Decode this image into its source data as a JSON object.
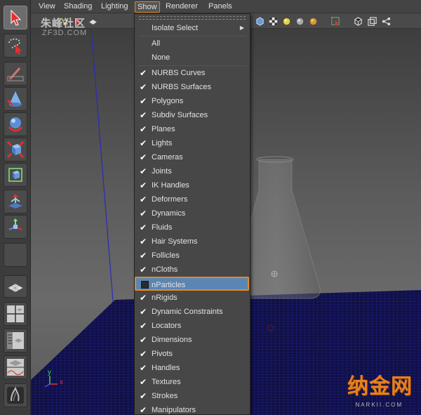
{
  "menubar": {
    "items": [
      {
        "label": "View"
      },
      {
        "label": "Shading"
      },
      {
        "label": "Lighting"
      },
      {
        "label": "Show"
      },
      {
        "label": "Renderer"
      },
      {
        "label": "Panels"
      }
    ]
  },
  "watermark": {
    "title": "朱峰社区",
    "subtitle": "ZF3D.COM"
  },
  "show_menu": {
    "isolate_label": "Isolate Select",
    "all_label": "All",
    "none_label": "None",
    "items": [
      {
        "label": "NURBS Curves",
        "checked": true
      },
      {
        "label": "NURBS Surfaces",
        "checked": true
      },
      {
        "label": "Polygons",
        "checked": true
      },
      {
        "label": "Subdiv Surfaces",
        "checked": true
      },
      {
        "label": "Planes",
        "checked": true
      },
      {
        "label": "Lights",
        "checked": true
      },
      {
        "label": "Cameras",
        "checked": true
      },
      {
        "label": "Joints",
        "checked": true
      },
      {
        "label": "IK Handles",
        "checked": true
      },
      {
        "label": "Deformers",
        "checked": true
      },
      {
        "label": "Dynamics",
        "checked": true
      },
      {
        "label": "Fluids",
        "checked": true
      },
      {
        "label": "Hair Systems",
        "checked": true
      },
      {
        "label": "Follicles",
        "checked": true
      },
      {
        "label": "nCloths",
        "checked": true
      },
      {
        "label": "nParticles",
        "checked": false
      },
      {
        "label": "nRigids",
        "checked": true
      },
      {
        "label": "Dynamic Constraints",
        "checked": true
      },
      {
        "label": "Locators",
        "checked": true
      },
      {
        "label": "Dimensions",
        "checked": true
      },
      {
        "label": "Pivots",
        "checked": true
      },
      {
        "label": "Handles",
        "checked": true
      },
      {
        "label": "Textures",
        "checked": true
      },
      {
        "label": "Strokes",
        "checked": true
      },
      {
        "label": "Manipulators",
        "checked": true
      }
    ]
  },
  "axis": {
    "y_label": "y",
    "x_label": "x"
  },
  "logo": {
    "text": "纳金网",
    "sub": "NARKII.COM"
  },
  "colors": {
    "accent": "#e08a2c",
    "highlight": "#5b86b3",
    "grid": "#1e1e8c"
  }
}
